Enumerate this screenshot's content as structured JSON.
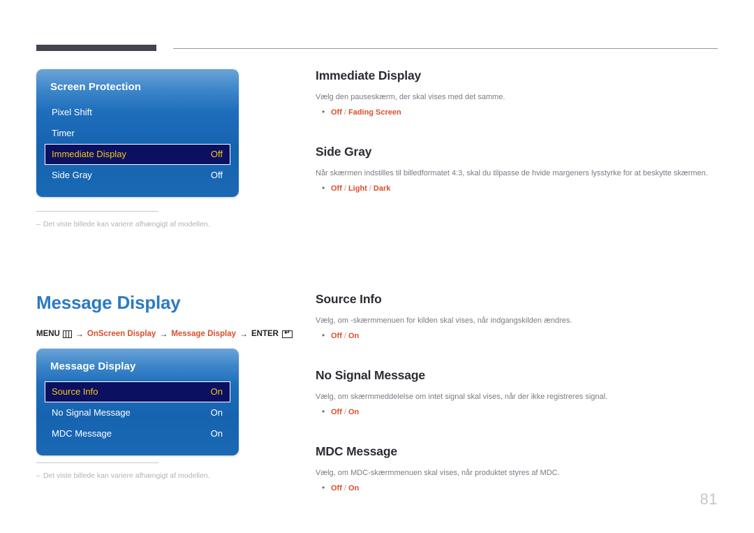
{
  "page": {
    "number": "81",
    "footnote": "Det viste billede kan variere afhængigt af modellen.",
    "footnote_dash": "–"
  },
  "header": {
    "accent_color": "#46434f",
    "rule_color": "#9a979e"
  },
  "section": {
    "title": "Message Display",
    "title_color": "#2b7ac2"
  },
  "breadcrumb": {
    "menu_label": "MENU",
    "menu_icon": "menu-icon",
    "arrow": "→",
    "path1": "OnScreen Display",
    "path2": "Message Display",
    "enter_label": "ENTER",
    "enter_icon": "enter-key-icon",
    "accent_color": "#d94f2b"
  },
  "osd_panels": [
    {
      "id": "screen-protection",
      "title": "Screen Protection",
      "rows": [
        {
          "label": "Pixel Shift",
          "value": "",
          "selected": false
        },
        {
          "label": "Timer",
          "value": "",
          "selected": false
        },
        {
          "label": "Immediate Display",
          "value": "Off",
          "selected": true
        },
        {
          "label": "Side Gray",
          "value": "Off",
          "selected": false
        }
      ]
    },
    {
      "id": "message-display",
      "title": "Message Display",
      "rows": [
        {
          "label": "Source Info",
          "value": "On",
          "selected": true
        },
        {
          "label": "No Signal Message",
          "value": "On",
          "selected": false
        },
        {
          "label": "MDC Message",
          "value": "On",
          "selected": false
        }
      ]
    }
  ],
  "content_top": [
    {
      "heading": "Immediate Display",
      "desc": "Vælg den pauseskærm, der skal vises med det samme.",
      "bullet": "•",
      "options": [
        "Off",
        "Fading Screen"
      ],
      "separator": "/"
    },
    {
      "heading": "Side Gray",
      "desc": "Når skærmen indstilles til billedformatet 4:3, skal du tilpasse de hvide margeners lysstyrke for at beskytte skærmen.",
      "bullet": "•",
      "options": [
        "Off",
        "Light",
        "Dark"
      ],
      "separator": "/"
    }
  ],
  "content_bottom": [
    {
      "heading": "Source Info",
      "desc": "Vælg, om -skærmmenuen for kilden skal vises, når indgangskilden ændres.",
      "bullet": "•",
      "options": [
        "Off",
        "On"
      ],
      "separator": "/"
    },
    {
      "heading": "No Signal Message",
      "desc": "Vælg, om skærmmeddelelse om intet signal skal vises, når der ikke registreres signal.",
      "bullet": "•",
      "options": [
        "Off",
        "On"
      ],
      "separator": "/"
    },
    {
      "heading": "MDC Message",
      "desc": "Vælg, om MDC-skærmmenuen skal vises, når produktet styres af MDC.",
      "bullet": "•",
      "options": [
        "Off",
        "On"
      ],
      "separator": "/"
    }
  ],
  "colors": {
    "option_accent": "#d94f2b",
    "osd_selected_bg": "#0b1061",
    "osd_selected_text": "#f5c518",
    "heading": "#2e2b33",
    "body_text": "#7c7984"
  }
}
